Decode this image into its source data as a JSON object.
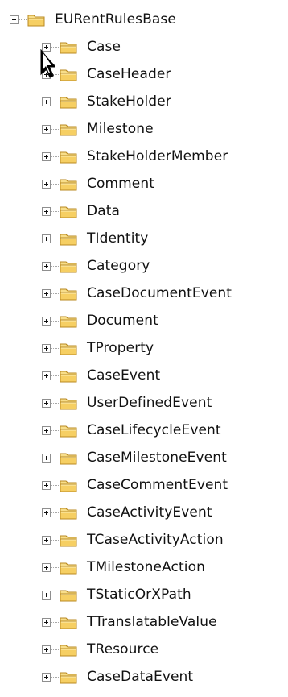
{
  "tree": {
    "root": {
      "label": "EURentRulesBase",
      "expanded": true,
      "icon": "folder-icon"
    },
    "items": [
      {
        "label": "Case",
        "icon": "folder-icon",
        "expanded": false
      },
      {
        "label": "CaseHeader",
        "icon": "folder-icon",
        "expanded": false
      },
      {
        "label": "StakeHolder",
        "icon": "folder-icon",
        "expanded": false
      },
      {
        "label": "Milestone",
        "icon": "folder-icon",
        "expanded": false
      },
      {
        "label": "StakeHolderMember",
        "icon": "folder-icon",
        "expanded": false
      },
      {
        "label": "Comment",
        "icon": "folder-icon",
        "expanded": false
      },
      {
        "label": "Data",
        "icon": "folder-icon",
        "expanded": false
      },
      {
        "label": "TIdentity",
        "icon": "folder-icon",
        "expanded": false
      },
      {
        "label": "Category",
        "icon": "folder-icon",
        "expanded": false
      },
      {
        "label": "CaseDocumentEvent",
        "icon": "folder-icon",
        "expanded": false
      },
      {
        "label": "Document",
        "icon": "folder-icon",
        "expanded": false
      },
      {
        "label": "TProperty",
        "icon": "folder-icon",
        "expanded": false
      },
      {
        "label": "CaseEvent",
        "icon": "folder-icon",
        "expanded": false
      },
      {
        "label": "UserDefinedEvent",
        "icon": "folder-icon",
        "expanded": false
      },
      {
        "label": "CaseLifecycleEvent",
        "icon": "folder-icon",
        "expanded": false
      },
      {
        "label": "CaseMilestoneEvent",
        "icon": "folder-icon",
        "expanded": false
      },
      {
        "label": "CaseCommentEvent",
        "icon": "folder-icon",
        "expanded": false
      },
      {
        "label": "CaseActivityEvent",
        "icon": "folder-icon",
        "expanded": false
      },
      {
        "label": "TCaseActivityAction",
        "icon": "folder-icon",
        "expanded": false
      },
      {
        "label": "TMilestoneAction",
        "icon": "folder-icon",
        "expanded": false
      },
      {
        "label": "TStaticOrXPath",
        "icon": "folder-icon",
        "expanded": false
      },
      {
        "label": "TTranslatableValue",
        "icon": "folder-icon",
        "expanded": false
      },
      {
        "label": "TResource",
        "icon": "folder-icon",
        "expanded": false
      },
      {
        "label": "CaseDataEvent",
        "icon": "folder-icon",
        "expanded": false
      }
    ]
  },
  "colors": {
    "folder_body": "#f6cf63",
    "folder_tab": "#f8de8a",
    "folder_outline": "#b98922",
    "connector": "#a8a8a8",
    "text": "#111111",
    "background": "#ffffff"
  },
  "cursor": {
    "icon": "mouse-pointer-icon"
  }
}
